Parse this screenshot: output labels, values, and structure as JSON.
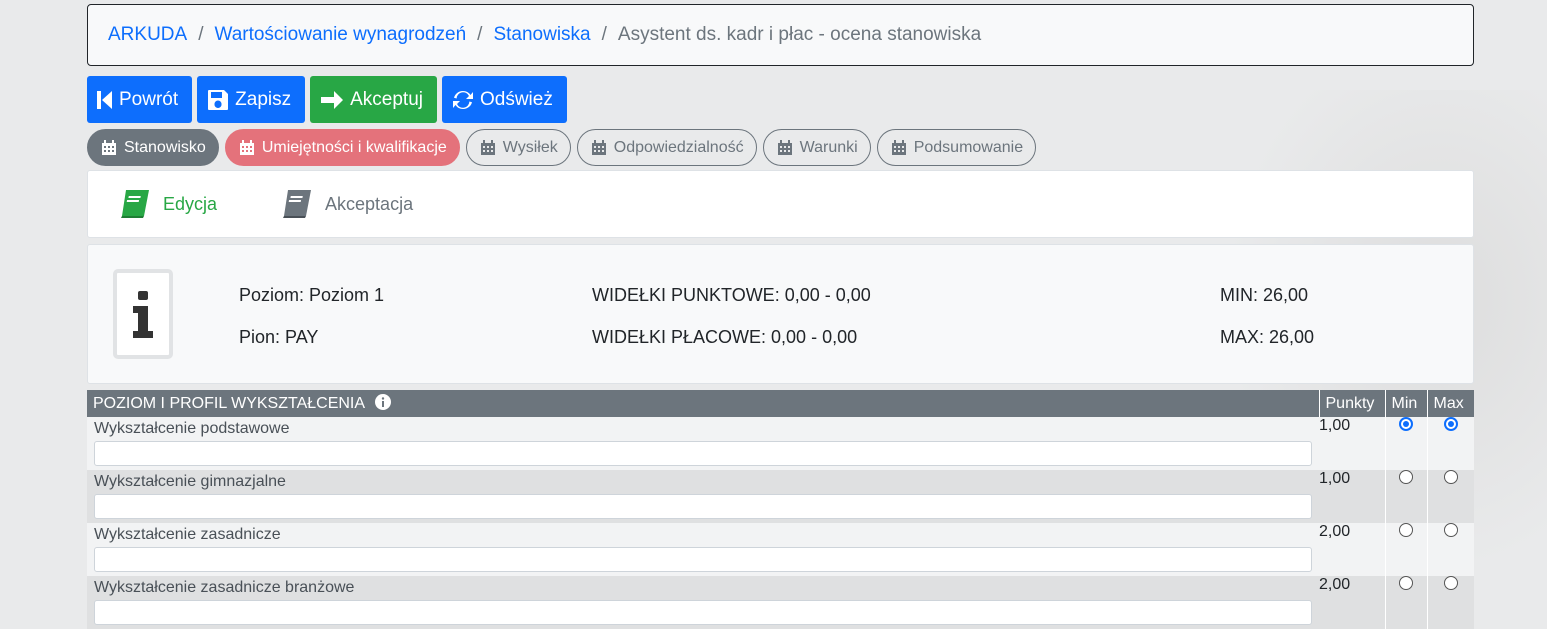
{
  "breadcrumb": {
    "items": [
      "ARKUDA",
      "Wartościowanie wynagrodzeń",
      "Stanowiska"
    ],
    "current": "Asystent ds. kadr i płac - ocena stanowiska"
  },
  "toolbar": {
    "back": "Powrót",
    "save": "Zapisz",
    "accept": "Akceptuj",
    "refresh": "Odśwież"
  },
  "tabs": [
    "Stanowisko",
    "Umiejętności i kwalifikacje",
    "Wysiłek",
    "Odpowiedzialność",
    "Warunki",
    "Podsumowanie"
  ],
  "modes": {
    "edit": "Edycja",
    "accept": "Akceptacja"
  },
  "info": {
    "level": "Poziom: Poziom 1",
    "pion": "Pion: PAY",
    "point_range": "WIDEŁKI PUNKTOWE: 0,00 - 0,00",
    "pay_range": "WIDEŁKI PŁACOWE: 0,00 - 0,00",
    "min": "MIN: 26,00",
    "max": "MAX: 26,00"
  },
  "table": {
    "header": "POZIOM I PROFIL WYKSZTAŁCENIA",
    "col_points": "Punkty",
    "col_min": "Min",
    "col_max": "Max",
    "rows": [
      {
        "label": "Wykształcenie podstawowe",
        "points": "1,00"
      },
      {
        "label": "Wykształcenie gimnazjalne",
        "points": "1,00"
      },
      {
        "label": "Wykształcenie zasadnicze",
        "points": "2,00"
      },
      {
        "label": "Wykształcenie zasadnicze branżowe",
        "points": "2,00"
      }
    ]
  },
  "colors": {
    "primary": "#0d6efd",
    "success": "#28a745",
    "secondary": "#6c757d",
    "danger_light": "#e4727b"
  }
}
